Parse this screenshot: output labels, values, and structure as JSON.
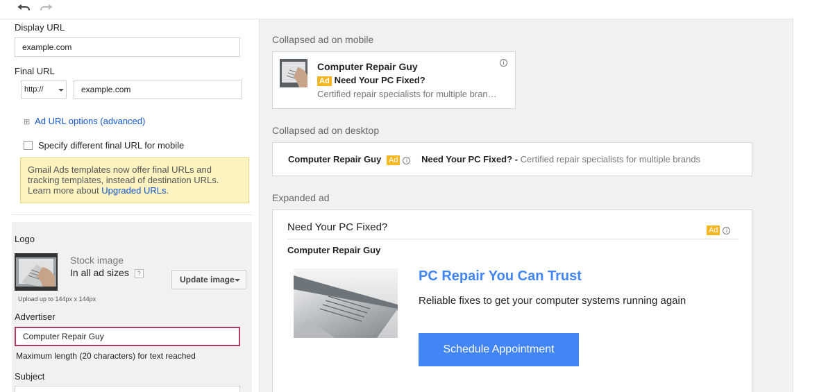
{
  "toolbar": {
    "undo_icon": "undo-icon",
    "redo_icon": "redo-icon"
  },
  "form": {
    "display_url_label": "Display URL",
    "display_url_value": "example.com",
    "final_url_label": "Final URL",
    "protocol_value": "http://",
    "final_url_value": "example.com",
    "url_options_link": "Ad URL options (advanced)",
    "url_options_icon": "⊞",
    "mobile_checkbox_label": "Specify different final URL for mobile",
    "notice_text": "Gmail Ads templates now offer final URLs and tracking templates, instead of destination URLs. Learn more about ",
    "notice_link": "Upgraded URLs",
    "notice_end": ".",
    "logo_label": "Logo",
    "stock_image_label": "Stock image",
    "ad_sizes_label": "In all ad sizes",
    "help_icon_text": "?",
    "update_button": "Update image",
    "upload_hint": "Upload up to 144px x 144px",
    "advertiser_label": "Advertiser",
    "advertiser_value": "Computer Repair Guy",
    "advertiser_error": "Maximum length (20 characters) for text reached",
    "subject_label": "Subject"
  },
  "preview": {
    "mobile_title": "Collapsed ad on mobile",
    "desktop_title": "Collapsed ad on desktop",
    "expanded_title": "Expanded ad",
    "advertiser": "Computer Repair Guy",
    "ad_badge": "Ad",
    "info_glyph": "i",
    "subject": "Need Your PC Fixed?",
    "mobile_description": "Certified repair specialists for multiple bran…",
    "desktop_separator": "-",
    "desktop_description": "Certified repair specialists for multiple brands",
    "headline": "PC Repair You Can Trust",
    "body": "Reliable fixes to get your computer systems running again",
    "cta": "Schedule Appointment"
  },
  "colors": {
    "accent_blue": "#4285f4",
    "ad_badge": "#f5b623",
    "notice_bg": "#fdf3c0",
    "link": "#1155cc"
  }
}
